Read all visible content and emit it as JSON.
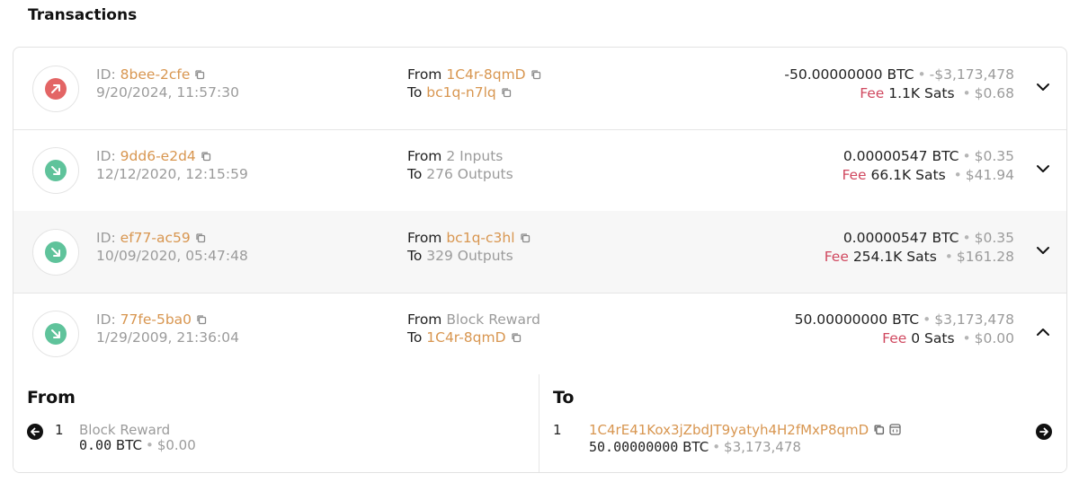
{
  "page": {
    "title": "Transactions"
  },
  "labels": {
    "id_prefix": "ID:",
    "from": "From",
    "to": "To",
    "fee": "Fee",
    "btc": "BTC",
    "sats": "Sats",
    "bullet": "•"
  },
  "transactions": [
    {
      "direction": "outgoing",
      "id": "8bee-2cfe",
      "date": "9/20/2024, 11:57:30",
      "from": {
        "text": "1C4r-8qmD",
        "type": "address"
      },
      "to": {
        "text": "bc1q-n7lq",
        "type": "address"
      },
      "amount_btc": "-50.00000000",
      "amount_usd": "-$3,173,478",
      "fee_sats": "1.1K",
      "fee_usd": "$0.68",
      "expanded": false
    },
    {
      "direction": "incoming",
      "id": "9dd6-e2d4",
      "date": "12/12/2020, 12:15:59",
      "from": {
        "text": "2 Inputs",
        "type": "count"
      },
      "to": {
        "text": "276 Outputs",
        "type": "count"
      },
      "amount_btc": "0.00000547",
      "amount_usd": "$0.35",
      "fee_sats": "66.1K",
      "fee_usd": "$41.94",
      "expanded": false
    },
    {
      "direction": "incoming",
      "id": "ef77-ac59",
      "date": "10/09/2020, 05:47:48",
      "from": {
        "text": "bc1q-c3hl",
        "type": "address"
      },
      "to": {
        "text": "329 Outputs",
        "type": "count"
      },
      "amount_btc": "0.00000547",
      "amount_usd": "$0.35",
      "fee_sats": "254.1K",
      "fee_usd": "$161.28",
      "expanded": false
    },
    {
      "direction": "incoming",
      "id": "77fe-5ba0",
      "date": "1/29/2009, 21:36:04",
      "from": {
        "text": "Block Reward",
        "type": "count"
      },
      "to": {
        "text": "1C4r-8qmD",
        "type": "address"
      },
      "amount_btc": "50.00000000",
      "amount_usd": "$3,173,478",
      "fee_sats": "0",
      "fee_usd": "$0.00",
      "expanded": true
    }
  ],
  "detail": {
    "from_heading": "From",
    "to_heading": "To",
    "input": {
      "index": "1",
      "label": "Block Reward",
      "amount_btc": "0.00",
      "btc_unit": "BTC",
      "amount_usd": "$0.00"
    },
    "output": {
      "index": "1",
      "address": "1C4rE41Kox3jZbdJT9yatyh4H2fMxP8qmD",
      "amount_btc": "50.00000000",
      "btc_unit": "BTC",
      "amount_usd": "$3,173,478"
    }
  },
  "colors": {
    "accent_orange": "#d89650",
    "fee_red": "#d0485f",
    "outgoing_red": "#e36565",
    "incoming_green": "#5fc39b"
  }
}
